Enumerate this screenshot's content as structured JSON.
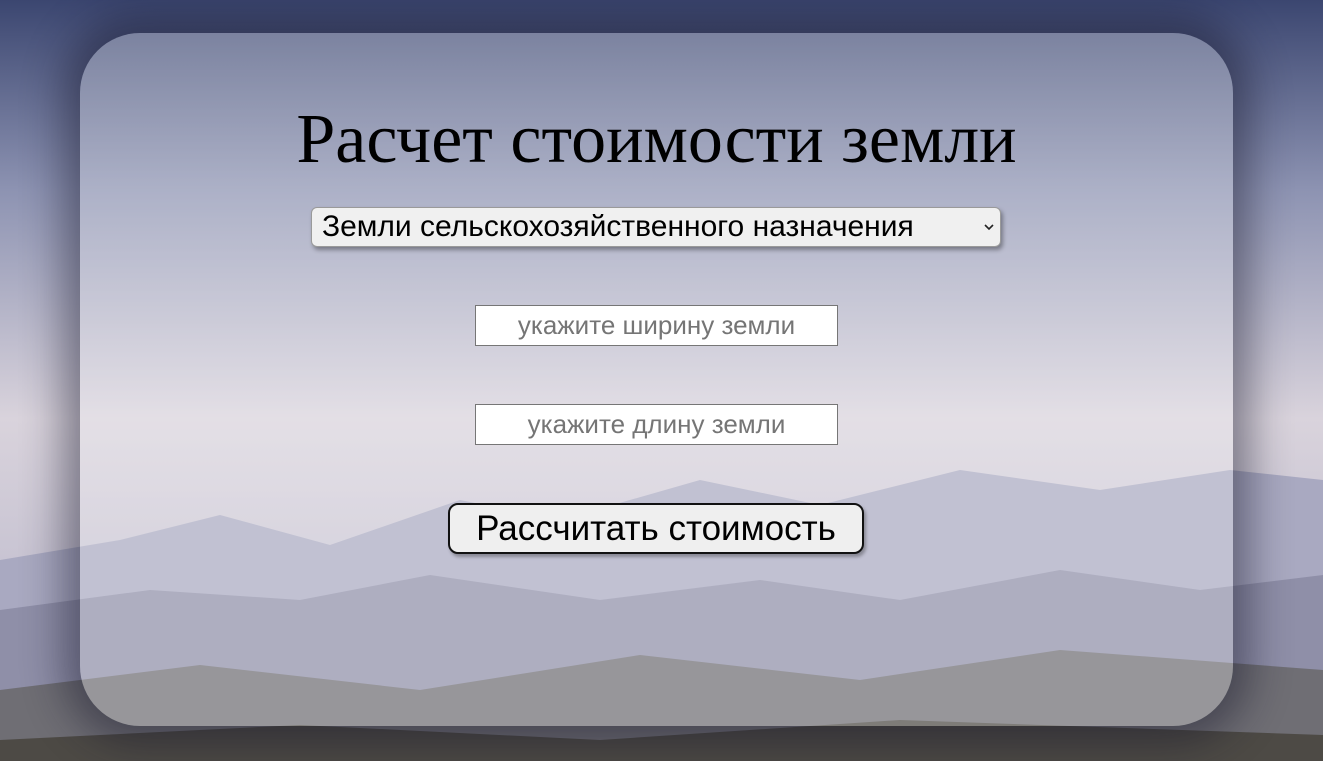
{
  "page": {
    "title": "Расчет стоимости земли"
  },
  "form": {
    "category_select": {
      "selected": "Земли сельскохозяйственного назначения"
    },
    "width_input": {
      "value": "",
      "placeholder": "укажите ширину земли"
    },
    "length_input": {
      "value": "",
      "placeholder": "укажите длину земли"
    },
    "submit_label": "Рассчитать стоимость"
  },
  "icons": {
    "select_arrow": "chevron-down-icon"
  },
  "colors": {
    "card_overlay": "#ffffff",
    "text": "#000000",
    "button_bg": "#efefef",
    "button_border": "#111111"
  }
}
